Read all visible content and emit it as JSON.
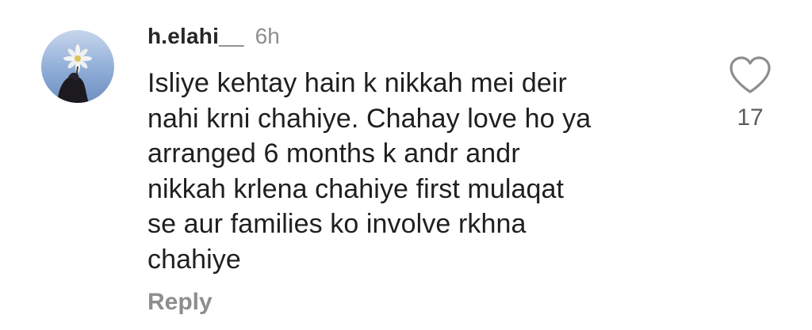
{
  "comment": {
    "username": "h.elahi__",
    "timestamp": "6h",
    "text": "Isliye kehtay hain k nikkah mei deir\nnahi krni chahiye. Chahay love ho ya\narranged 6 months k andr andr\nnikkah krlena chahiye first mulaqat\nse aur families ko involve rkhna\nchahiye",
    "reply_label": "Reply",
    "like_count": "17",
    "like_icon": "heart-outline-icon",
    "avatar_description": "hand-holding-flower-photo"
  },
  "colors": {
    "username": "#262626",
    "muted": "#8e8e8e",
    "body": "#1f1f1f",
    "like_icon": "#8e8e8e"
  }
}
